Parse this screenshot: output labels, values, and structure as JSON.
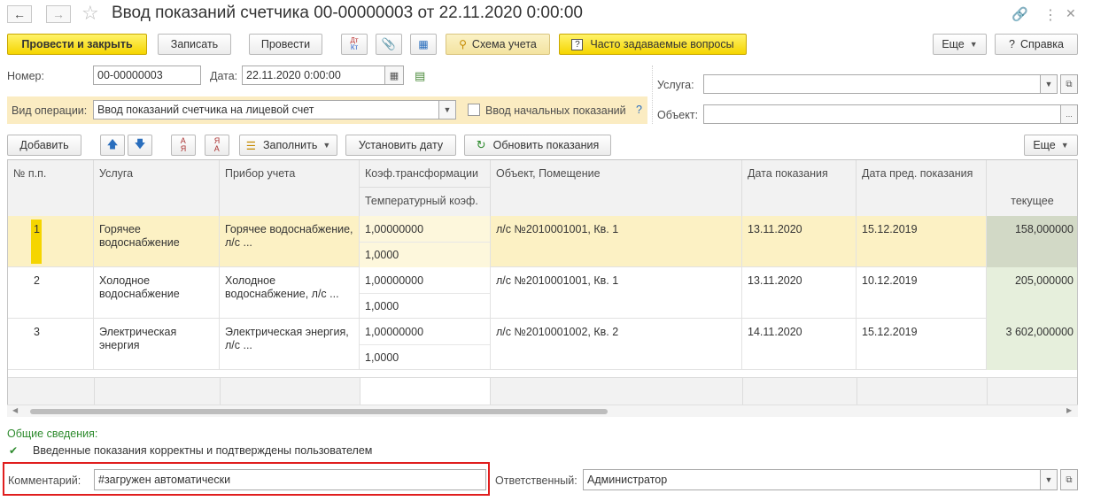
{
  "window": {
    "title": "Ввод показаний счетчика 00-00000003 от 22.11.2020 0:00:00"
  },
  "toolbar": {
    "post_close": "Провести и закрыть",
    "save": "Записать",
    "post": "Провести",
    "dt_kt": "Дт Кт",
    "scheme": "Схема учета",
    "faq": "Часто задаваемые вопросы",
    "more": "Еще",
    "help": "Справка"
  },
  "header": {
    "number_label": "Номер:",
    "number_value": "00-00000003",
    "date_label": "Дата:",
    "date_value": "22.11.2020  0:00:00",
    "operation_label": "Вид операции:",
    "operation_value": "Ввод показаний счетчика на лицевой счет",
    "initial_readings_label": "Ввод начальных показаний",
    "help_q": "?",
    "service_label": "Услуга:",
    "service_value": "",
    "object_label": "Объект:",
    "object_value": "",
    "dots": "..."
  },
  "table_toolbar": {
    "add": "Добавить",
    "fill": "Заполнить",
    "set_date": "Установить дату",
    "refresh": "Обновить показания",
    "more": "Еще"
  },
  "table": {
    "columns": {
      "num": "№ п.п.",
      "service": "Услуга",
      "device": "Прибор учета",
      "coef": "Коэф.трансформации",
      "temp_coef": "Температурный коэф.",
      "object": "Объект, Помещение",
      "date": "Дата показания",
      "prev_date": "Дата пред. показания",
      "current": "текущее"
    },
    "rows": [
      {
        "num": "1",
        "service": "Горячее водоснабжение",
        "device": "Горячее водоснабжение, л/с ...",
        "coef": "1,00000000",
        "temp_coef": "1,0000",
        "object": "л/с №2010001001, Кв. 1",
        "date": "13.11.2020",
        "prev_date": "15.12.2019",
        "current": "158,000000"
      },
      {
        "num": "2",
        "service": "Холодное водоснабжение",
        "device": "Холодное водоснабжение, л/с ...",
        "coef": "1,00000000",
        "temp_coef": "1,0000",
        "object": "л/с №2010001001, Кв. 1",
        "date": "13.11.2020",
        "prev_date": "10.12.2019",
        "current": "205,000000"
      },
      {
        "num": "3",
        "service": "Электрическая энергия",
        "device": "Электрическая энергия, л/с ...",
        "coef": "1,00000000",
        "temp_coef": "1,0000",
        "object": "л/с №2010001002, Кв. 2",
        "date": "14.11.2020",
        "prev_date": "15.12.2019",
        "current": "3 602,000000"
      }
    ]
  },
  "footer": {
    "general_info": "Общие сведения:",
    "confirmed_text": "Введенные показания корректны и подтверждены пользователем",
    "comment_label": "Комментарий:",
    "comment_value": "#загружен автоматически",
    "responsible_label": "Ответственный:",
    "responsible_value": "Администратор"
  },
  "colors": {
    "accent_yellow": "#f5d500",
    "operation_band": "#fbecc2",
    "selected_row": "#fcf1c4",
    "highlight_red": "#e01e1e",
    "link_green": "#2e8b2e"
  }
}
